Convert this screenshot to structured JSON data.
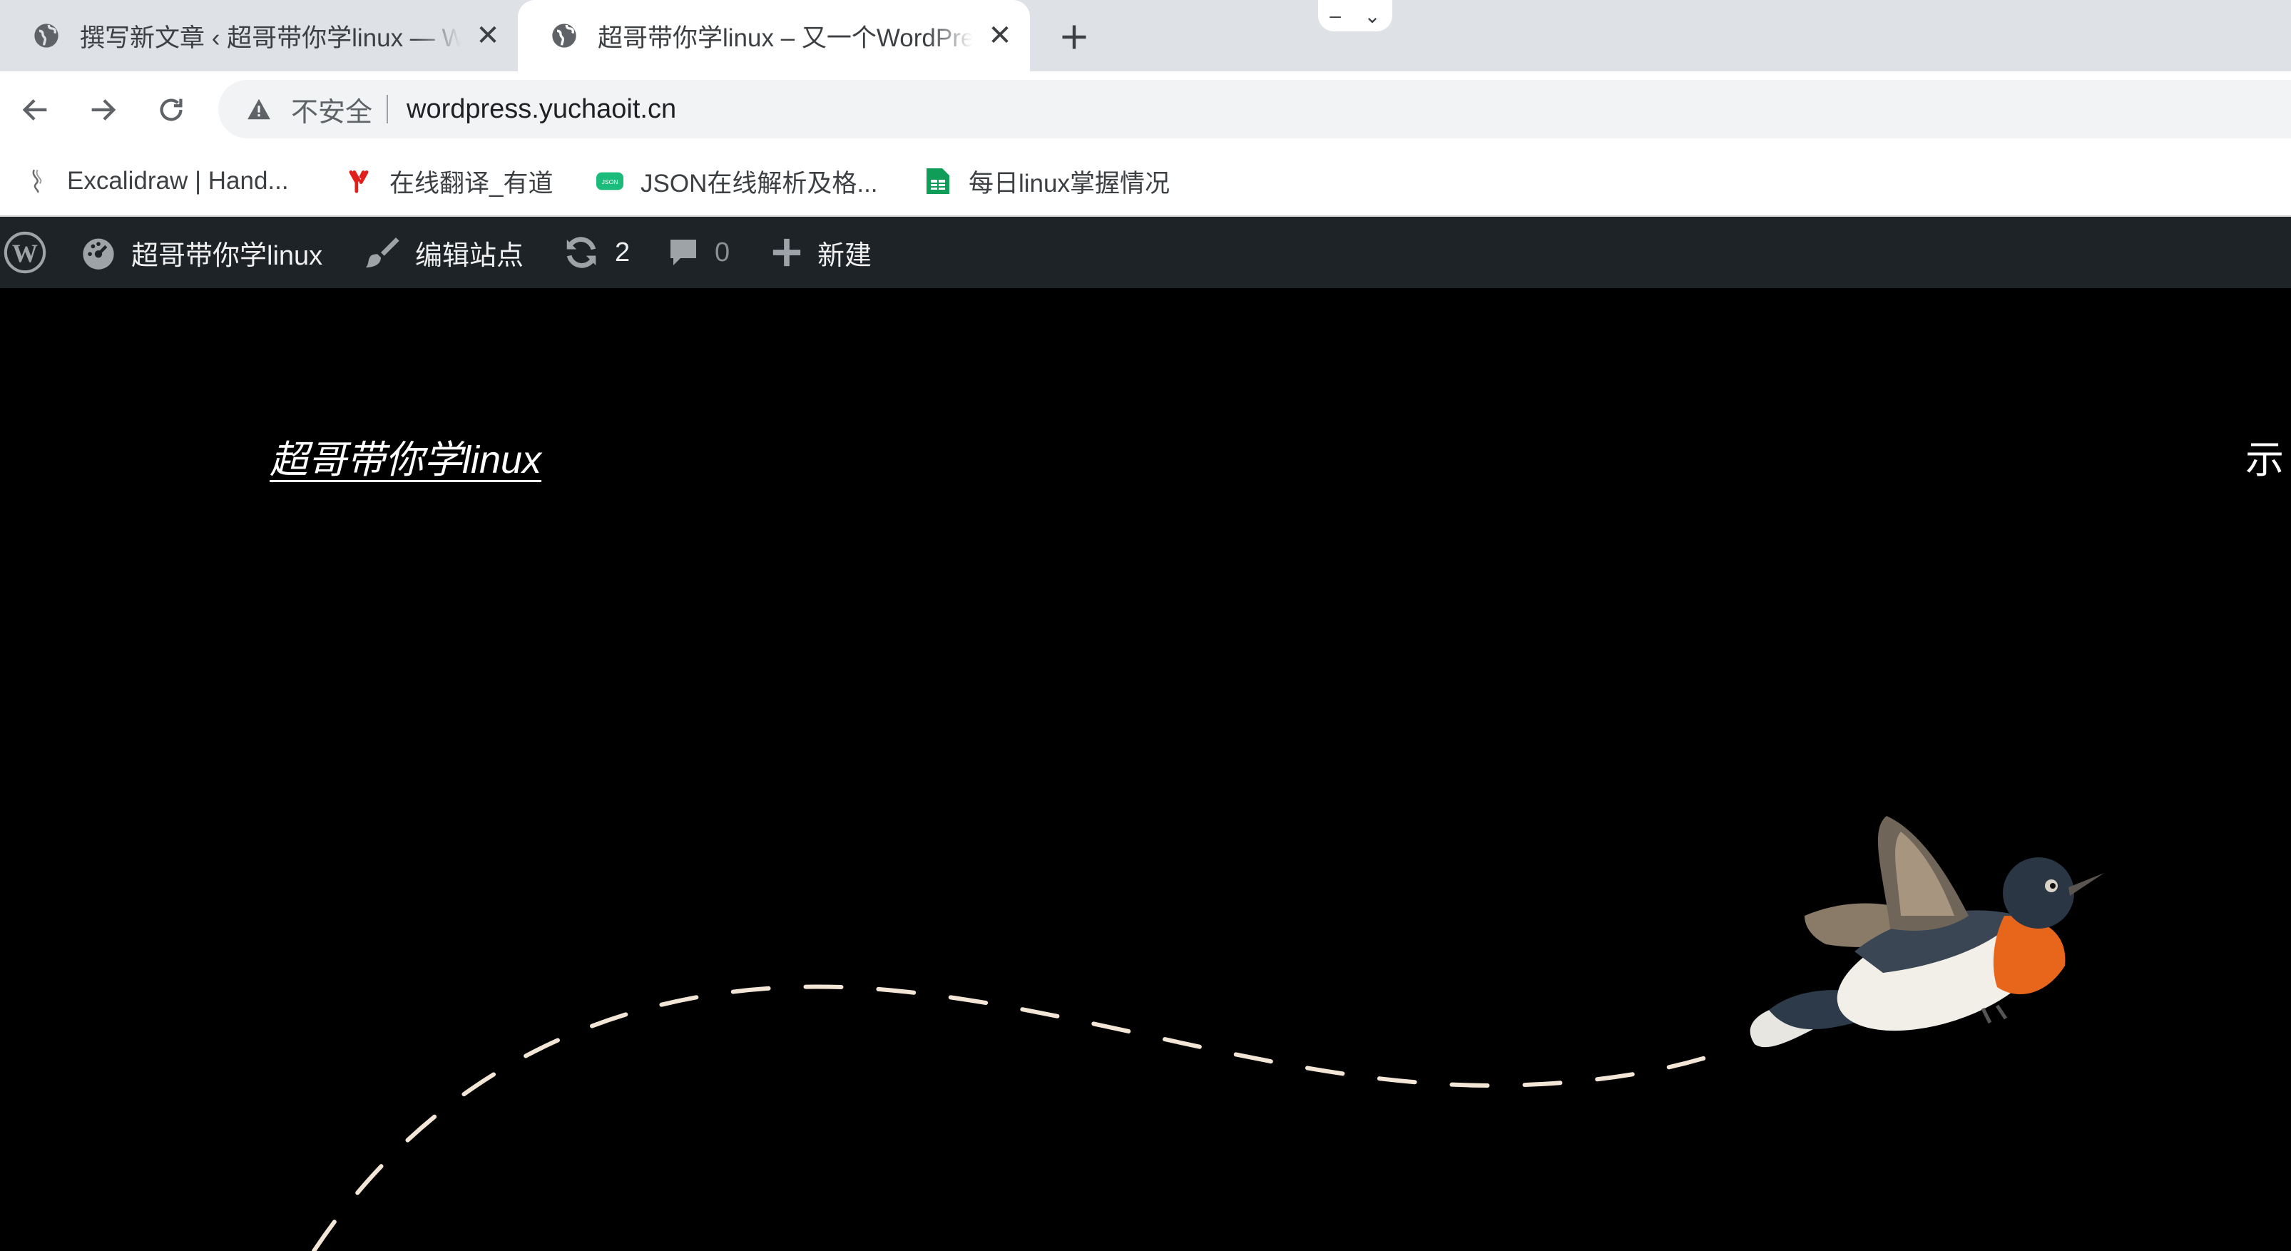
{
  "browser": {
    "tabs": [
      {
        "title": "撰写新文章 ‹ 超哥带你学linux — WordPress",
        "active": false
      },
      {
        "title": "超哥带你学linux – 又一个WordPress站点",
        "active": true
      }
    ],
    "new_tab": "+",
    "address": {
      "security_label": "不安全",
      "url": "wordpress.yuchaoit.cn"
    },
    "bookmarks": [
      {
        "label": "Excalidraw | Hand...",
        "icon": "excalidraw-icon"
      },
      {
        "label": "在线翻译_有道",
        "icon": "youdao-icon"
      },
      {
        "label": "JSON在线解析及格...",
        "icon": "json-icon"
      },
      {
        "label": "每日linux掌握情况",
        "icon": "sheets-icon"
      }
    ]
  },
  "admin_bar": {
    "site_name": "超哥带你学linux",
    "customize": "编辑站点",
    "updates_count": "2",
    "comments_count": "0",
    "new_label": "新建"
  },
  "site": {
    "title": "超哥带你学linux",
    "nav_first": "示"
  },
  "colors": {
    "tabstrip": "#dee1e6",
    "adminbar": "#1d2327",
    "page_bg": "#000000",
    "dash_line": "#f3e6d6",
    "bird_orange": "#e8661c"
  }
}
